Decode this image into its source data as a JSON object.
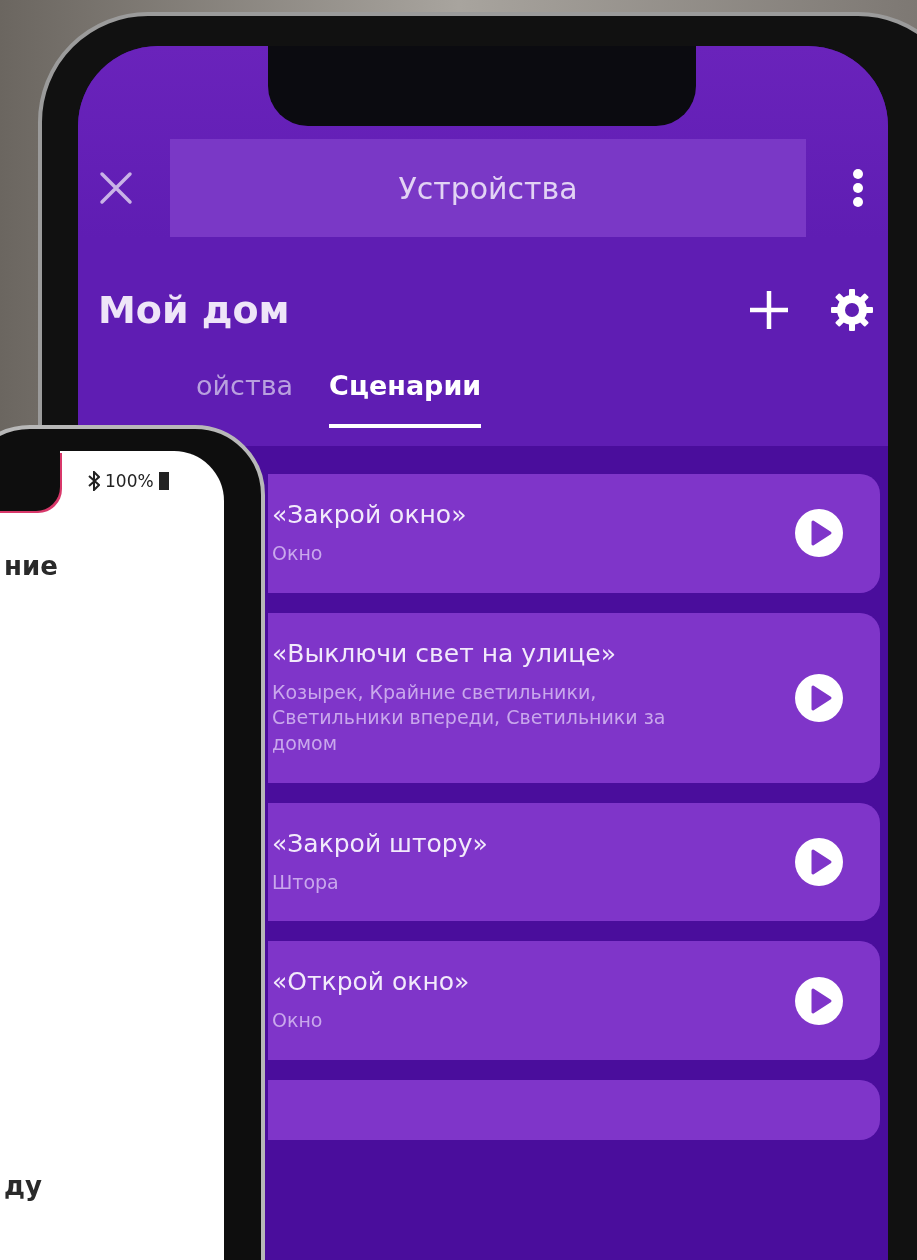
{
  "header": {
    "title": "Устройства"
  },
  "home": {
    "title": "Мой дом"
  },
  "tabs": [
    {
      "label": "ойства",
      "selected": false
    },
    {
      "label": "Сценарии",
      "selected": true
    }
  ],
  "scenarios": [
    {
      "title": "«Закрой окно»",
      "devices": "Окно"
    },
    {
      "title": "«Выключи свет на улице»",
      "devices": "Козырек, Крайние светильники, Светильники впереди, Светильники за домом"
    },
    {
      "title": "«Закрой штору»",
      "devices": "Штора"
    },
    {
      "title": "«Открой окно»",
      "devices": "Окно"
    }
  ],
  "front_phone": {
    "battery": "100%",
    "texts": [
      "ние",
      "ду"
    ]
  }
}
